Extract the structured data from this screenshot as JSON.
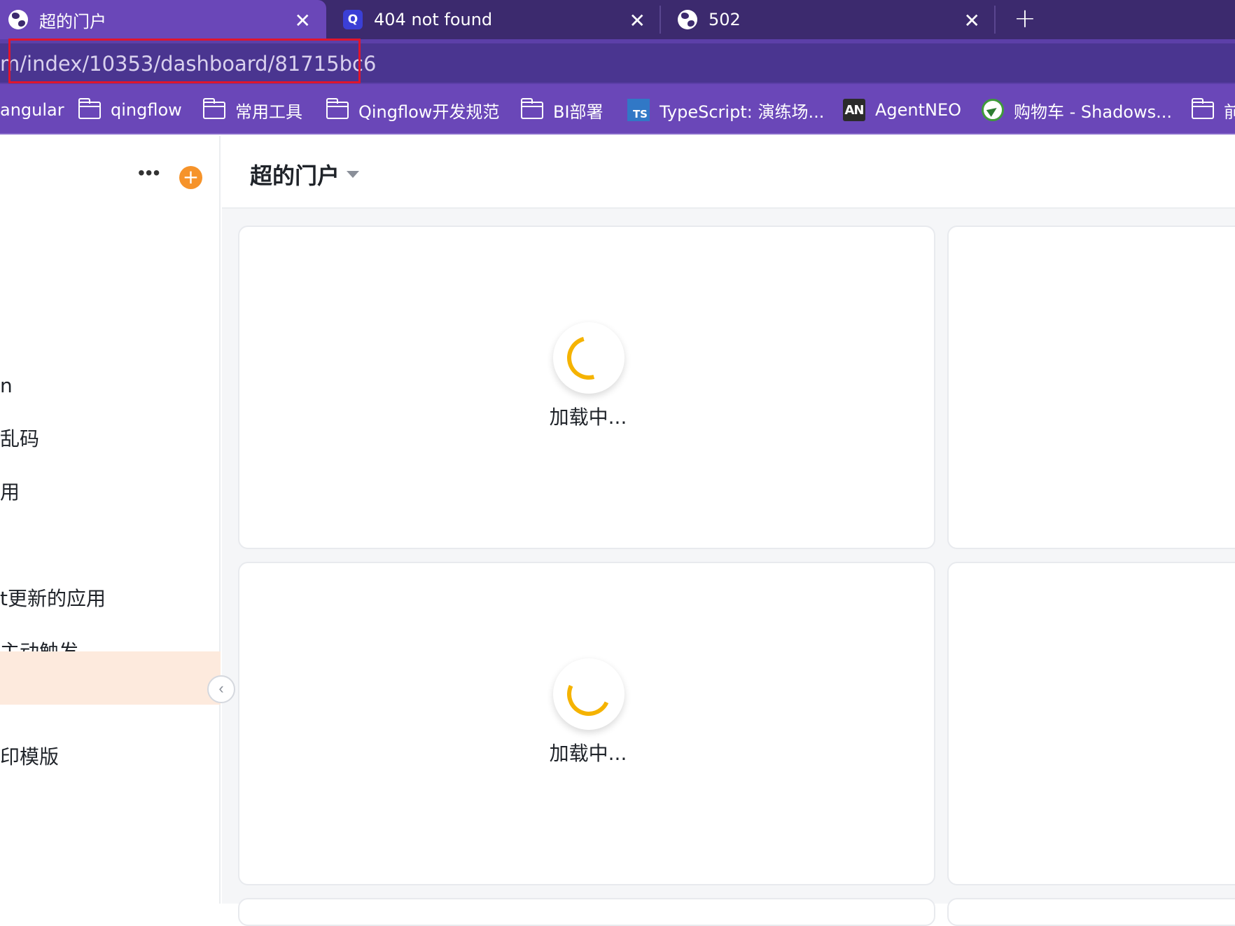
{
  "tabs": [
    {
      "title": "超的门户",
      "icon": "globe-icon",
      "active": true
    },
    {
      "title": "404 not found",
      "icon": "q-app-icon",
      "active": false
    },
    {
      "title": "502",
      "icon": "globe-icon",
      "active": false
    }
  ],
  "tab_close_glyph": "✕",
  "new_tab_glyph": "+",
  "address_bar": {
    "url": "m/index/10353/dashboard/81715bc6"
  },
  "bookmarks": [
    {
      "label": "angular",
      "icon": "none"
    },
    {
      "label": "qingflow",
      "icon": "folder-icon"
    },
    {
      "label": "常用工具",
      "icon": "folder-icon"
    },
    {
      "label": "Qingflow开发规范",
      "icon": "folder-icon"
    },
    {
      "label": "BI部署",
      "icon": "folder-icon"
    },
    {
      "label": "TypeScript: 演练场...",
      "icon": "typescript-icon"
    },
    {
      "label": "AgentNEO",
      "icon": "agentneo-icon"
    },
    {
      "label": "购物车 - Shadows...",
      "icon": "shadowsocks-icon"
    },
    {
      "label": "前",
      "icon": "folder-icon"
    }
  ],
  "bookmark_icon_text": {
    "ts": "TS",
    "an": "AN"
  },
  "sidebar": {
    "more_glyph": "•••",
    "add_glyph": "+",
    "items": [
      {
        "label": "n",
        "selected": false
      },
      {
        "label": "乱码",
        "selected": false
      },
      {
        "label": "用",
        "selected": false
      },
      {
        "label": "t更新的应用",
        "selected": false
      },
      {
        "label": "主动触发",
        "selected": false
      },
      {
        "label": "",
        "selected": true
      },
      {
        "label": "印模版",
        "selected": false
      }
    ],
    "collapse_glyph": "‹"
  },
  "main": {
    "title": "超的门户",
    "cards": [
      {
        "loading_text": "加载中..."
      },
      {
        "loading_text": ""
      },
      {
        "loading_text": "加载中..."
      },
      {
        "loading_text": ""
      }
    ]
  },
  "colors": {
    "tabstrip": "#3c2a6e",
    "active_tab": "#6a47b8",
    "url_highlight": "#e0152d",
    "spinner": "#f5b300",
    "add_button": "#f6932a",
    "selected_item": "#fdeadd"
  }
}
